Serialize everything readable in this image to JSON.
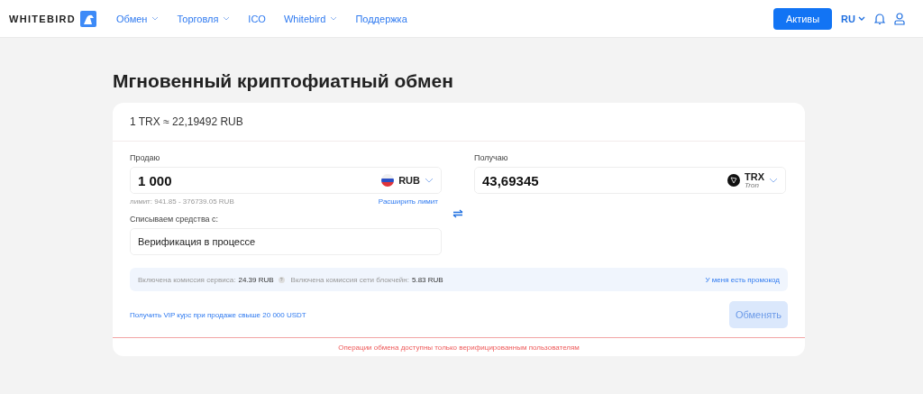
{
  "header": {
    "logo": "WHITEBIRD",
    "nav": [
      {
        "label": "Обмен",
        "dropdown": true
      },
      {
        "label": "Торговля",
        "dropdown": true
      },
      {
        "label": "ICO",
        "dropdown": false
      },
      {
        "label": "Whitebird",
        "dropdown": true
      },
      {
        "label": "Поддержка",
        "dropdown": false
      }
    ],
    "assets_button": "Активы",
    "language": "RU"
  },
  "title": "Мгновенный криптофиатный обмен",
  "rate": "1 TRX ≈ 22,19492 RUB",
  "sell": {
    "label": "Продаю",
    "value": "1 000",
    "currency": "RUB",
    "limit": "лимит: 941.85 - 376739.05 RUB",
    "extend_link": "Расширить лимит"
  },
  "source": {
    "label": "Списываем средства с:",
    "value": "Верификация в процессе"
  },
  "receive": {
    "label": "Получаю",
    "value": "43,69345",
    "currency": "TRX",
    "currency_name": "Tron"
  },
  "fees": {
    "service_label": "Включена комиссия сервиса:",
    "service_value": "24.39 RUB",
    "help": "?",
    "network_label": "Включена комиссия сети блокчейн:",
    "network_value": "5.83 RUB",
    "promo_link": "У меня есть промокод"
  },
  "vip_link": "Получить VIP курс при продаже свыше 20 000 USDT",
  "exchange_button": {
    "label": "Обменять",
    "disabled": true
  },
  "warning": "Операции обмена доступны только верифицированным пользователям"
}
